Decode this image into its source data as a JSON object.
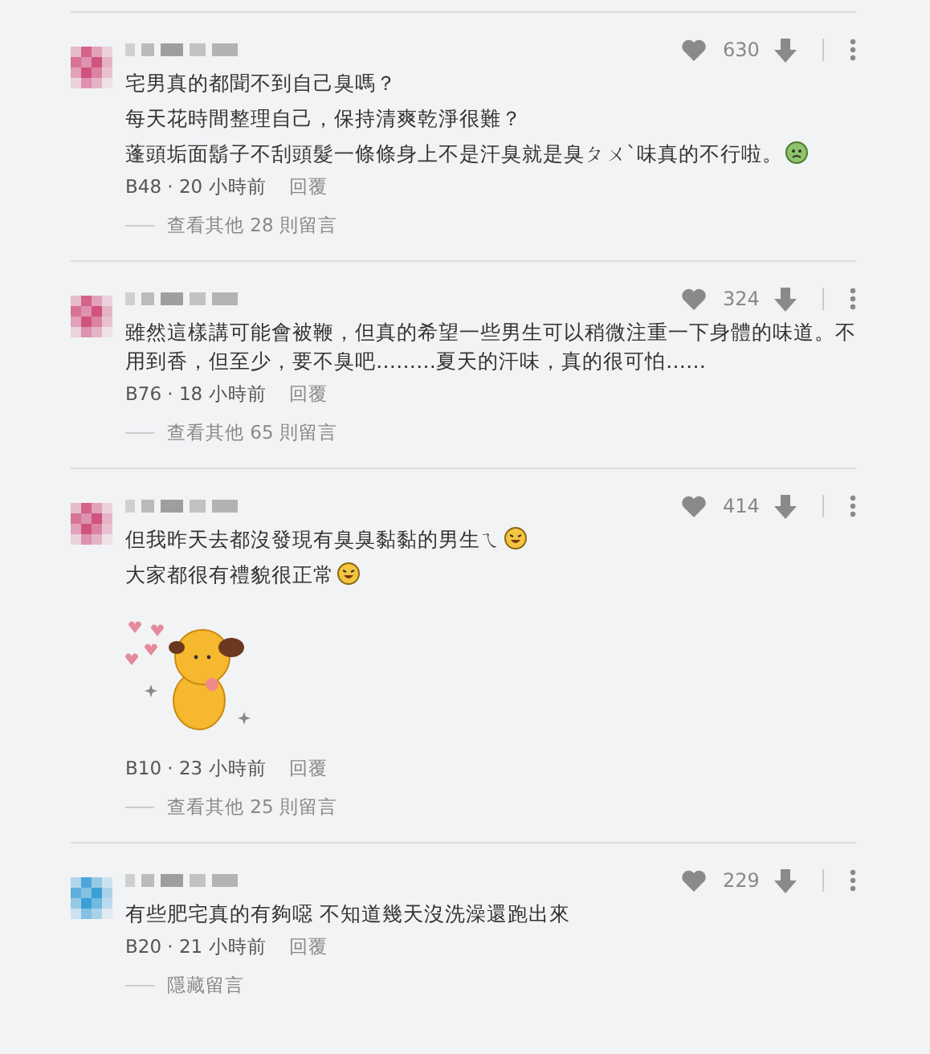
{
  "comments": [
    {
      "color": "#d0527f",
      "lines": [
        {
          "kind": "plain",
          "text": "宅男真的都聞不到自己臭嗎？"
        },
        {
          "kind": "plain",
          "text": "每天花時間整理自己，保持清爽乾淨很難？"
        },
        {
          "kind": "sick_emoji",
          "text": "蓬頭垢面鬍子不刮頭髮一條條身上不是汗臭就是臭ㄆㄨ`味真的不行啦。"
        }
      ],
      "likes": "630",
      "meta": "B48 · 20 小時前",
      "reply": "回覆",
      "thread": "查看其他 28 則留言",
      "sticker": false
    },
    {
      "color": "#d0527f",
      "lines": [
        {
          "kind": "plain",
          "text": "雖然這樣講可能會被鞭，但真的希望一些男生可以稍微注重一下身體的味道。不用到香，但至少，要不臭吧………夏天的汗味，真的很可怕……"
        }
      ],
      "likes": "324",
      "meta": "B76 · 18 小時前",
      "reply": "回覆",
      "thread": "查看其他 65 則留言",
      "sticker": false
    },
    {
      "color": "#d0527f",
      "lines": [
        {
          "kind": "laugh_emoji",
          "text": "但我昨天去都沒發現有臭臭黏黏的男生ㄟ"
        },
        {
          "kind": "laugh_emoji",
          "text": "大家都很有禮貌很正常"
        }
      ],
      "likes": "414",
      "meta": "B10 · 23 小時前",
      "reply": "回覆",
      "thread": "查看其他 25 則留言",
      "sticker": true
    },
    {
      "color": "#3b9fd6",
      "lines": [
        {
          "kind": "plain",
          "text": "有些肥宅真的有夠噁 不知道幾天沒洗澡還跑出來"
        }
      ],
      "likes": "229",
      "meta": "B20 · 21 小時前",
      "reply": "回覆",
      "thread": "隱藏留言",
      "sticker": false
    }
  ]
}
